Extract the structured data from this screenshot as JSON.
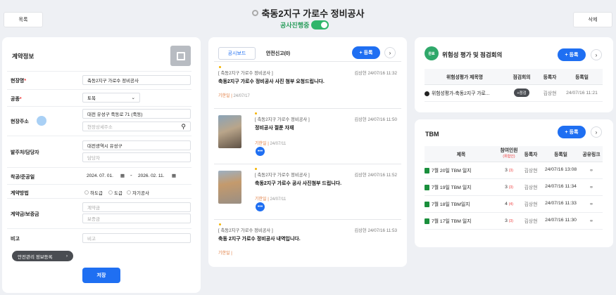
{
  "header": {
    "list_btn": "목록",
    "title": "축동2지구 가로수 정비공사",
    "status": "공사진행중",
    "delete_btn": "삭제"
  },
  "contract": {
    "title": "계약정보",
    "site_name_label": "현장명",
    "site_name": "축동2지구 가로수 정비공사",
    "work_type_label": "공종",
    "work_type": "토목",
    "address_label": "현장주소",
    "address": "대전 유성구 죽동로 71 (죽동)",
    "address_detail_ph": "현장상세주소",
    "client_label": "발주처/담당자",
    "client": "대전광역시 유성구",
    "manager_ph": "담당자",
    "dates_label": "착공/준공일",
    "start": "2024. 07. 01.",
    "end": "2026. 02. 11.",
    "method_label": "계약방법",
    "methods": [
      "하도급",
      "도급",
      "자기공사"
    ],
    "amount_label": "계약금/보증금",
    "amount_ph": "계약금",
    "deposit_ph": "보증금",
    "note_label": "비고",
    "note_ph": "비고",
    "safety_btn": "안전관리 정보등록",
    "save_btn": "저장"
  },
  "board": {
    "tab1": "공시보드",
    "tab2": "안전신고(0)",
    "add": "+ 등록",
    "posts": [
      {
        "tag": "[ 축동2지구 가로수 정비공사          ]",
        "title": "축동2지구 가로수 정비공사 사진 첨부 요청드립니다.",
        "meta": "김상현 24/07/16 11:32",
        "sub": "기한일",
        "date": "24/07/17"
      },
      {
        "tag": "[ 축동2지구 가로수 정비공사      ]",
        "title": "정비공사 절푼 자재",
        "meta": "김상현 24/07/16 11:50",
        "sub": "기한일",
        "date": "24/07/11"
      },
      {
        "tag": "[ 축동2지구 가로수 정비공사      ]",
        "title": "축동2지구 가로수 공사 사진첨부 드립니다.",
        "meta": "김상현 24/07/16 11:52",
        "sub": "기한일",
        "date": "24/07/11"
      },
      {
        "tag": "[ 축동2지구 가로수 정비공사          ]",
        "title": "축동 2지구 가로수 정비공사 내역입니다.",
        "meta": "김상현 24/07/16 11:53",
        "sub": "기한일",
        "date": ""
      }
    ]
  },
  "risk": {
    "badge": "완료",
    "title": "위험성 평가 및 점검회의",
    "add": "+ 등록",
    "cols": [
      "위험성평가 제목명",
      "점검회의",
      "등록자",
      "등록일"
    ],
    "rows": [
      {
        "name": "위험성평가-축동2지구 가로...",
        "check": "+점검",
        "user": "김상현",
        "date": "24/07/16 11:21"
      }
    ]
  },
  "tbm": {
    "title": "TBM",
    "add": "+ 등록",
    "cols": [
      "제목",
      "참여인원",
      "등록자",
      "등록일",
      "공유링크"
    ],
    "cols_sub": "(위험인)",
    "rows": [
      {
        "name": "7월 20일 TBM 일지",
        "count": "3",
        "risk": "(3)",
        "user": "김상현",
        "date": "24/07/16 13:08"
      },
      {
        "name": "7월 19일 TBM 일지",
        "count": "3",
        "risk": "(3)",
        "user": "김상현",
        "date": "24/07/16 11:34"
      },
      {
        "name": "7월 18일 TBM일지",
        "count": "4",
        "risk": "(4)",
        "user": "김상현",
        "date": "24/07/16 11:33"
      },
      {
        "name": "7월 17일 TBM 일지",
        "count": "3",
        "risk": "(3)",
        "user": "김상현",
        "date": "24/07/16 11:30"
      }
    ]
  }
}
